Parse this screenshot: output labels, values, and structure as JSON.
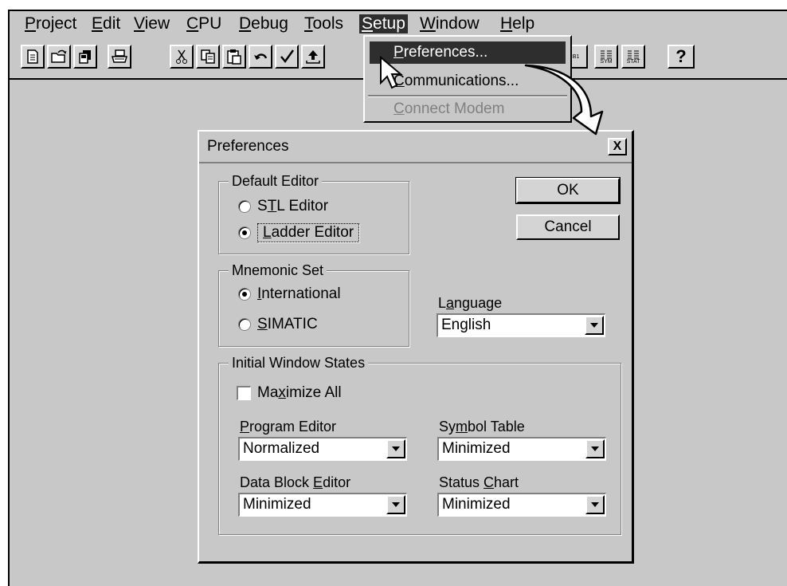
{
  "menubar": {
    "items": [
      {
        "pre": "",
        "u": "P",
        "post": "roject"
      },
      {
        "pre": "",
        "u": "E",
        "post": "dit"
      },
      {
        "pre": "",
        "u": "V",
        "post": "iew"
      },
      {
        "pre": "",
        "u": "C",
        "post": "PU"
      },
      {
        "pre": "",
        "u": "D",
        "post": "ebug"
      },
      {
        "pre": "",
        "u": "T",
        "post": "ools"
      },
      {
        "pre": "",
        "u": "S",
        "post": "etup"
      },
      {
        "pre": "",
        "u": "W",
        "post": "indow"
      },
      {
        "pre": "",
        "u": "H",
        "post": "elp"
      }
    ],
    "active_index": 6
  },
  "toolbar": {
    "buttons": [
      "new-icon",
      "open-icon",
      "copy-project-icon",
      "print-icon",
      "cut-icon",
      "copy-icon",
      "paste-icon",
      "undo-icon",
      "compile-icon",
      "upload-icon"
    ],
    "right_labels": {
      "db1": "B1",
      "sym": "SYM",
      "stat": "STAT",
      "help": "?"
    }
  },
  "setup_menu": {
    "items": [
      {
        "pre": "",
        "u": "P",
        "post": "references...",
        "state": "highlighted"
      },
      {
        "pre": "",
        "u": "C",
        "post": "ommunications...",
        "state": "normal"
      },
      {
        "pre": "",
        "u": "C",
        "post": "onnect Modem",
        "state": "disabled"
      }
    ]
  },
  "dialog": {
    "title": "Preferences",
    "close_label": "X",
    "ok_label": "OK",
    "cancel_label": "Cancel",
    "default_editor": {
      "label": "Default Editor",
      "stl": {
        "pre": "S",
        "u": "T",
        "post": "L Editor",
        "selected": false
      },
      "ladder": {
        "pre": "",
        "u": "L",
        "post": "adder Editor",
        "selected": true
      }
    },
    "mnemonic_set": {
      "label": "Mnemonic Set",
      "international": {
        "pre": "",
        "u": "I",
        "post": "nternational",
        "selected": true
      },
      "simatic": {
        "pre": "",
        "u": "S",
        "post": "IMATIC",
        "selected": false
      }
    },
    "language": {
      "pre": "L",
      "u": "a",
      "post": "nguage",
      "value": "English"
    },
    "initial_window_states": {
      "label": "Initial Window States",
      "maximize_all": {
        "pre": "Ma",
        "u": "x",
        "post": "imize All",
        "checked": false
      },
      "program_editor": {
        "pre": "",
        "u": "P",
        "post": "rogram Editor",
        "value": "Normalized"
      },
      "symbol_table": {
        "pre": "Sy",
        "u": "m",
        "post": "bol Table",
        "value": "Minimized"
      },
      "data_block_editor": {
        "pre": "Data Block ",
        "u": "E",
        "post": "ditor",
        "value": "Minimized"
      },
      "status_chart": {
        "pre": "Status ",
        "u": "C",
        "post": "hart",
        "value": "Minimized"
      }
    }
  }
}
